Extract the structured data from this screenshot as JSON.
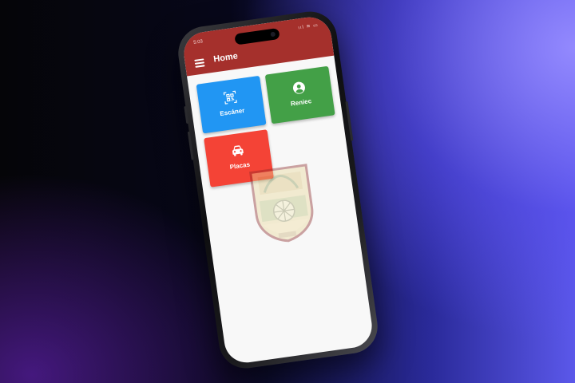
{
  "status_bar": {
    "time": "5:03",
    "icons": "ııl ≋ ▭"
  },
  "app_bar": {
    "title": "Home",
    "menu_icon": "hamburger-menu-icon"
  },
  "tiles": [
    {
      "label": "Escáner",
      "icon": "qr-code-scanner-icon",
      "color": "#2196f3"
    },
    {
      "label": "Reniec",
      "icon": "account-circle-icon",
      "color": "#43a047"
    },
    {
      "label": "Placas",
      "icon": "car-icon",
      "color": "#f44336"
    }
  ],
  "colors": {
    "app_bar": "#a5302c",
    "screen_bg": "#f8f8f8"
  },
  "watermark": {
    "type": "coat-of-arms-emblem"
  }
}
